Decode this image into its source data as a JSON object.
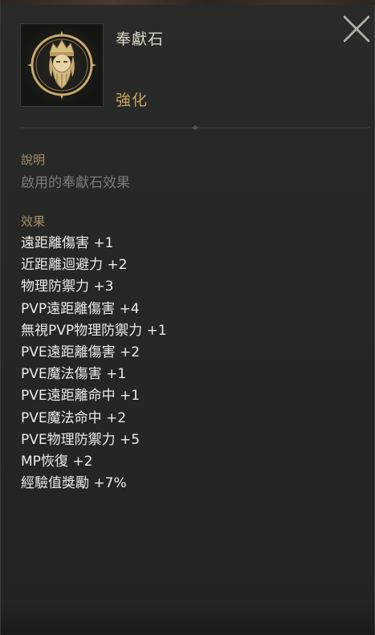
{
  "item": {
    "name": "奉獻石",
    "category": "強化",
    "icon": "bearded-figure-emblem-icon"
  },
  "description": {
    "heading": "說明",
    "text": "啟用的奉獻石效果"
  },
  "effects": {
    "heading": "效果",
    "items": [
      "遠距離傷害 +1",
      "近距離迴避力 +2",
      "物理防禦力 +3",
      "PVP遠距離傷害 +4",
      "無視PVP物理防禦力 +1",
      "PVE遠距離傷害 +2",
      "PVE魔法傷害 +1",
      "PVE遠距離命中 +1",
      "PVE魔法命中 +2",
      "PVE物理防禦力 +5",
      "MP恢復 +2",
      "經驗值獎勵 +7%"
    ]
  },
  "controls": {
    "close_icon": "close-icon"
  },
  "colors": {
    "background": "#262725",
    "title": "#dcd6c8",
    "category": "#c9a35a",
    "heading": "#a38e6a",
    "description": "#7c7a74",
    "effect_text": "#eceae4",
    "icon_gold": "#c9ab6e"
  }
}
